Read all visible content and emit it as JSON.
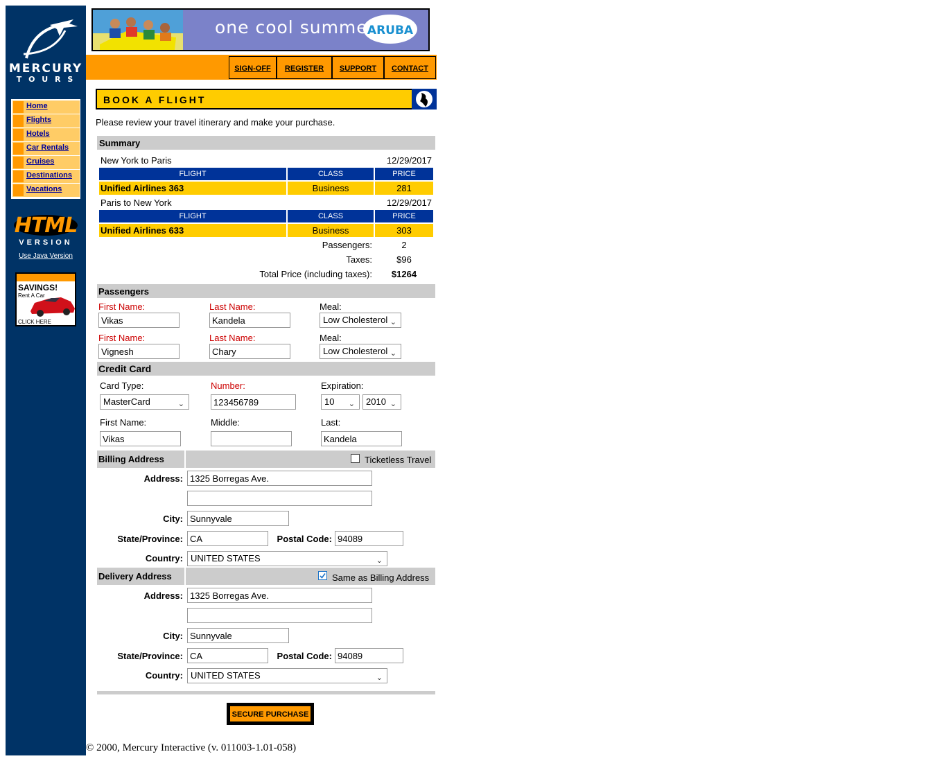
{
  "brand": {
    "line1": "MERCURY",
    "line2": "T O U R S"
  },
  "banner": {
    "text": "one cool summer",
    "badge": "ARUBA"
  },
  "topnav": [
    "SIGN-OFF",
    "REGISTER",
    "SUPPORT",
    "CONTACT"
  ],
  "sidenav": [
    "Home",
    "Flights",
    "Hotels",
    "Car Rentals",
    "Cruises",
    "Destinations",
    "Vacations"
  ],
  "html_version": {
    "line1": "HTML",
    "line2": "VERSION",
    "link": "Use Java Version"
  },
  "ad": {
    "title": "SAVINGS!",
    "sub": "Rent A Car",
    "cta": "CLICK HERE"
  },
  "page": {
    "title": "BOOK A FLIGHT",
    "intro": "Please review your travel itinerary and make your purchase."
  },
  "summary": {
    "header": "Summary",
    "col_flight": "FLIGHT",
    "col_class": "CLASS",
    "col_price": "PRICE",
    "legs": [
      {
        "route": "New York to Paris",
        "date": "12/29/2017",
        "flight": "Unified Airlines 363",
        "class": "Business",
        "price": "281"
      },
      {
        "route": "Paris to New York",
        "date": "12/29/2017",
        "flight": "Unified Airlines 633",
        "class": "Business",
        "price": "303"
      }
    ],
    "passengers_label": "Passengers:",
    "passengers": "2",
    "taxes_label": "Taxes:",
    "taxes": "$96",
    "total_label": "Total Price (including taxes):",
    "total": "$1264"
  },
  "passengers": {
    "header": "Passengers",
    "first_label": "First Name:",
    "last_label": "Last Name:",
    "meal_label": "Meal:",
    "list": [
      {
        "first": "Vikas",
        "last": "Kandela",
        "meal": "Low Cholesterol"
      },
      {
        "first": "Vignesh",
        "last": "Chary",
        "meal": "Low Cholesterol"
      }
    ]
  },
  "credit": {
    "header": "Credit Card",
    "type_label": "Card Type:",
    "type": "MasterCard",
    "number_label": "Number:",
    "number": "123456789",
    "exp_label": "Expiration:",
    "exp_month": "10",
    "exp_year": "2010",
    "first_label": "First Name:",
    "first": "Vikas",
    "middle_label": "Middle:",
    "middle": "",
    "last_label": "Last:",
    "last": "Kandela"
  },
  "billing": {
    "header": "Billing Address",
    "ticketless_label": "Ticketless Travel",
    "address_label": "Address:",
    "address1": "1325 Borregas Ave.",
    "address2": "",
    "city_label": "City:",
    "city": "Sunnyvale",
    "state_label": "State/Province:",
    "state": "CA",
    "postal_label": "Postal Code:",
    "postal": "94089",
    "country_label": "Country:",
    "country": "UNITED STATES"
  },
  "delivery": {
    "header": "Delivery Address",
    "same_label": "Same as Billing Address",
    "address_label": "Address:",
    "address1": "1325 Borregas Ave.",
    "address2": "",
    "city_label": "City:",
    "city": "Sunnyvale",
    "state_label": "State/Province:",
    "state": "CA",
    "postal_label": "Postal Code:",
    "postal": "94089",
    "country_label": "Country:",
    "country": "UNITED STATES"
  },
  "submit": "SECURE PURCHASE",
  "footer": "© 2000, Mercury Interactive (v. 011003-1.01-058)",
  "colors": {
    "navy": "#003366",
    "orange": "#ff9900",
    "gold": "#ffcc00",
    "table_blue": "#003399"
  }
}
